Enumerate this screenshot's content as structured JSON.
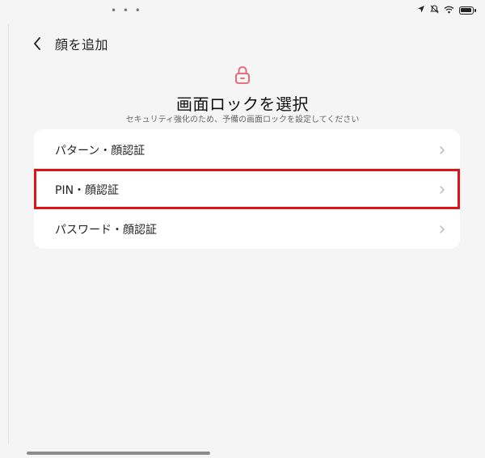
{
  "status_bar": {
    "dots": "• • •",
    "icons": [
      "location-icon",
      "mute-icon",
      "wifi-icon",
      "battery-icon"
    ]
  },
  "header": {
    "title": "顔を追加"
  },
  "main": {
    "heading": "画面ロックを選択",
    "subheading": "セキュリティ強化のため、予備の画面ロックを設定してください",
    "lock_icon_color": "#e85d6a",
    "options": [
      {
        "label": "パターン・顔認証"
      },
      {
        "label": "PIN・顔認証"
      },
      {
        "label": "パスワード・顔認証"
      }
    ]
  },
  "highlight_color": "#e01414"
}
